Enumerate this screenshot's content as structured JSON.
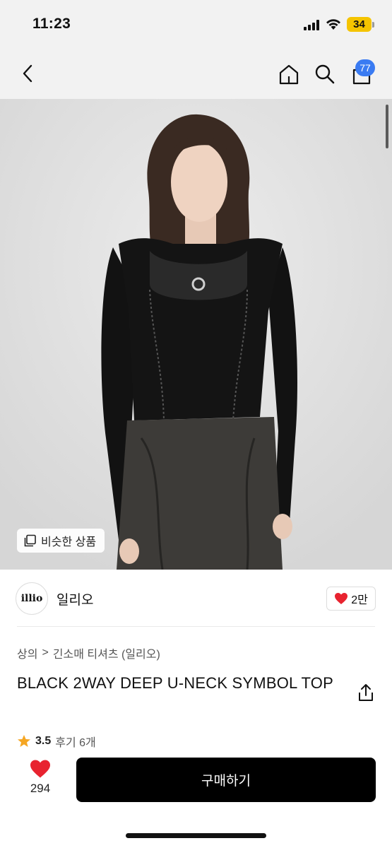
{
  "status_bar": {
    "time": "11:23",
    "battery": "34"
  },
  "nav": {
    "cart_count": "77",
    "icons": [
      "back-icon",
      "home-icon",
      "search-icon",
      "cart-icon"
    ]
  },
  "product_image": {
    "similar_label": "비슷한 상품"
  },
  "brand": {
    "logo_text": "illio",
    "name": "일리오",
    "like_count": "2만"
  },
  "breadcrumb": {
    "category": "상의",
    "separator": ">",
    "subcategory": "긴소매 티셔츠 (일리오)"
  },
  "product": {
    "title": "BLACK 2WAY DEEP U-NECK SYMBOL TOP",
    "rating": "3.5",
    "reviews": "후기 6개"
  },
  "bottom_bar": {
    "wish_count": "294",
    "buy_label": "구매하기"
  },
  "colors": {
    "accent": "#3a7bf2",
    "heart": "#e8232f",
    "star": "#f5a623",
    "buy_button": "#000000"
  }
}
